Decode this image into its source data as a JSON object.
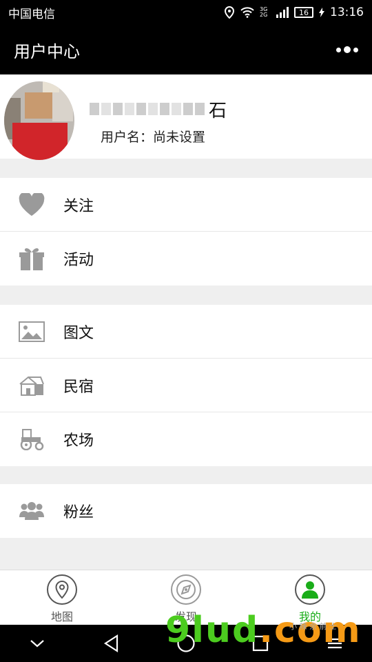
{
  "status": {
    "carrier": "中国电信",
    "battery": "16",
    "time": "13:16",
    "network_top": "3G",
    "network_bottom": "2G"
  },
  "header": {
    "title": "用户中心"
  },
  "profile": {
    "nickname_tail": "石",
    "username": "用户名：尚未设置"
  },
  "menu": {
    "group1": [
      {
        "label": "关注",
        "icon": "heart-icon"
      },
      {
        "label": "活动",
        "icon": "gift-icon"
      }
    ],
    "group2": [
      {
        "label": "图文",
        "icon": "image-icon"
      },
      {
        "label": "民宿",
        "icon": "house-icon"
      },
      {
        "label": "农场",
        "icon": "tractor-icon"
      }
    ],
    "group3": [
      {
        "label": "粉丝",
        "icon": "people-icon"
      }
    ]
  },
  "tabs": [
    {
      "label": "地图",
      "icon": "map-pin-icon"
    },
    {
      "label": "发现",
      "icon": "compass-icon"
    },
    {
      "label": "我的",
      "icon": "user-icon",
      "active": true
    }
  ],
  "watermark": {
    "text": "9lud",
    "suffix": ".com",
    "small": "小 辣 余 前 士"
  },
  "colors": {
    "accent": "#1aad19",
    "header_bg": "#000000",
    "icon_gray": "#9a9a9a"
  }
}
